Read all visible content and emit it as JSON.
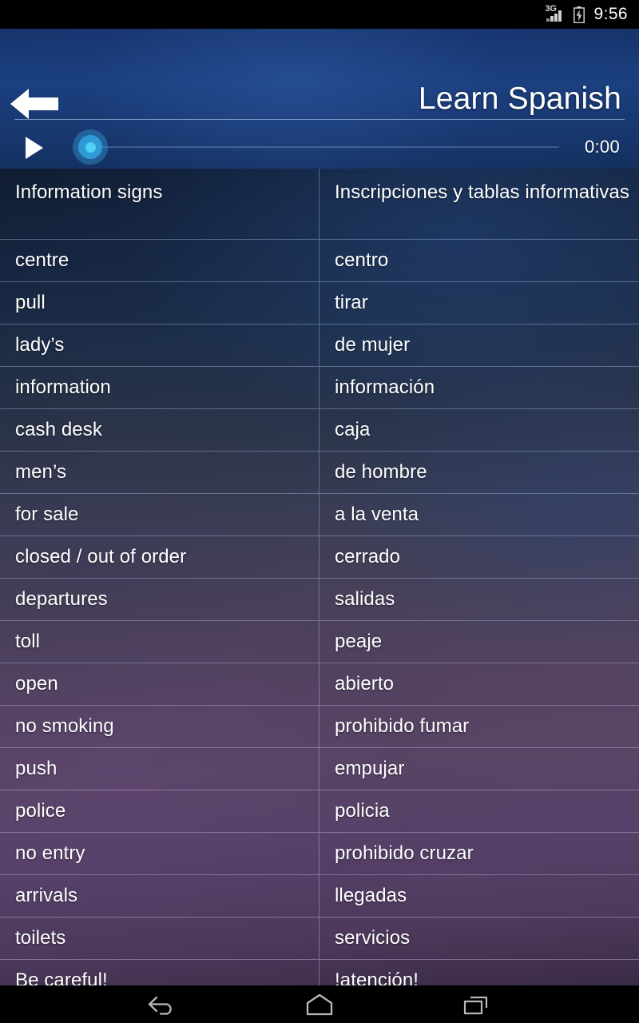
{
  "status_bar": {
    "network_label": "3G",
    "time": "9:56",
    "signal_icon": "signal-bars-icon",
    "battery_icon": "battery-charging-icon"
  },
  "header": {
    "back_icon": "back-arrow-icon",
    "title": "Learn Spanish"
  },
  "player": {
    "play_icon": "play-icon",
    "time_elapsed": "0:00",
    "progress_percent": 0
  },
  "table": {
    "header": {
      "left": "Information signs",
      "right": "Inscripciones y tablas informativas"
    },
    "rows": [
      {
        "left": "centre",
        "right": "centro"
      },
      {
        "left": "pull",
        "right": "tirar"
      },
      {
        "left": "lady’s",
        "right": "de mujer"
      },
      {
        "left": "information",
        "right": "información"
      },
      {
        "left": "cash desk",
        "right": "caja"
      },
      {
        "left": "men’s",
        "right": "de hombre"
      },
      {
        "left": "for sale",
        "right": "a la venta"
      },
      {
        "left": "closed / out of order",
        "right": "cerrado"
      },
      {
        "left": "departures",
        "right": "salidas"
      },
      {
        "left": "toll",
        "right": "peaje"
      },
      {
        "left": "open",
        "right": "abierto"
      },
      {
        "left": "no smoking",
        "right": "prohibido fumar"
      },
      {
        "left": "push",
        "right": "empujar"
      },
      {
        "left": "police",
        "right": "policia"
      },
      {
        "left": "no entry",
        "right": "prohibido cruzar"
      },
      {
        "left": "arrivals",
        "right": "llegadas"
      },
      {
        "left": "toilets",
        "right": "servicios"
      },
      {
        "left": "Be careful!",
        "right": "!atención!"
      }
    ]
  },
  "nav_bar": {
    "back_icon": "nav-back-icon",
    "home_icon": "nav-home-icon",
    "recents_icon": "nav-recents-icon"
  },
  "colors": {
    "header_blue": "#1b4080",
    "accent_cyan": "#2f9ad6",
    "thumb_core": "#4fd2f5",
    "separator": "#a8bee4",
    "text": "#ffffff",
    "system_black": "#000000"
  }
}
